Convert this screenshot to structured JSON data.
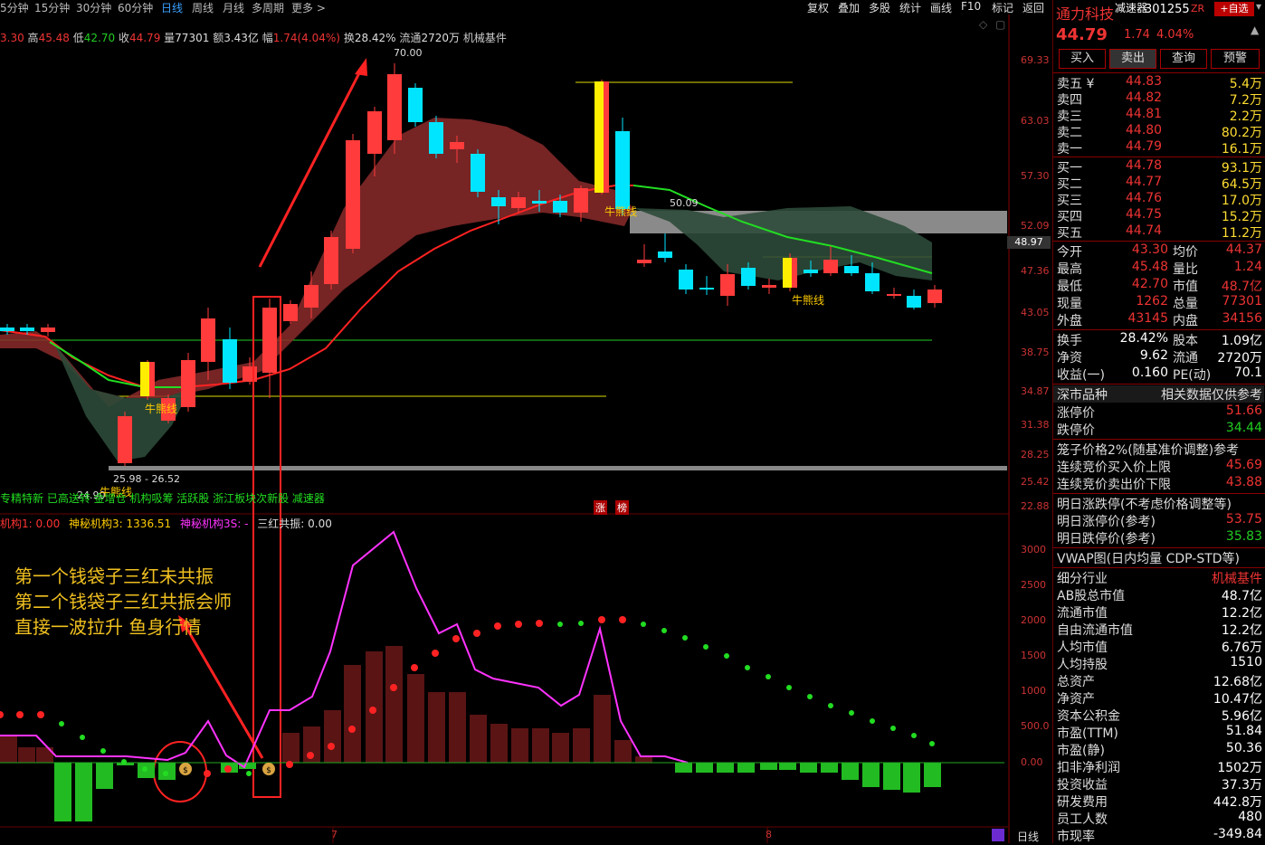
{
  "timeframes": [
    "5分钟",
    "15分钟",
    "30分钟",
    "60分钟",
    "日线",
    "周线",
    "月线",
    "多周期",
    "更多 >"
  ],
  "active_timeframe": "日线",
  "toolbar_right": [
    "复权",
    "叠加",
    "多股",
    "统计",
    "画线",
    "F10",
    "标记",
    "返回"
  ],
  "info": {
    "open": "3.30",
    "high_label": "高",
    "high": "45.48",
    "low_label": "低",
    "low": "42.70",
    "close_label": "收",
    "close": "44.79",
    "vol_label": "量",
    "vol": "77301",
    "amt_label": "额",
    "amt": "3.43亿",
    "chg_label": "幅",
    "chg": "1.74(4.04%)",
    "turn_label": "换",
    "turn": "28.42%",
    "float_label": "流通",
    "float": "2720万",
    "sector": "机械基件"
  },
  "annotations": {
    "high_mark": "70.00",
    "range_label": "25.98 - 26.52",
    "ma_value": "50.09",
    "price_tag": "48.97",
    "bull_bear_line": "牛熊线",
    "bottom_left_price": "24.90",
    "tag1": "涨",
    "tag2": "榜"
  },
  "concept_bar": "专精特新 已高送转 金增仓 机构吸筹 活跃股 浙江板块次新股 减速器",
  "indicator": {
    "label1": "机构1: 0.00",
    "label2": "神秘机构3: 1336.51",
    "label3": "神秘机构3S: -",
    "label4": "三红共振: 0.00"
  },
  "callout": [
    "第一个钱袋子三红未共振",
    "第二个钱袋子三红共振会师",
    "直接一波拉升  鱼身行情"
  ],
  "yaxis_main": [
    "69.33",
    "63.03",
    "57.30",
    "52.09",
    "47.36",
    "43.05",
    "38.75",
    "34.87",
    "31.38",
    "28.25",
    "25.42",
    "22.88"
  ],
  "yaxis_ind": [
    "3000",
    "2500",
    "2000",
    "1500",
    "1000",
    "500.0",
    "0.00"
  ],
  "xaxis": [
    "7",
    "8"
  ],
  "period_tag": "日线",
  "colors": {
    "up": "#ff3333",
    "down": "#00e5ff",
    "ma_green": "#22dd22",
    "ma_red": "#ff2222",
    "accent": "#ffcc00"
  },
  "right_panel": {
    "name": "通力科技",
    "tag": "减速器",
    "code": "301255",
    "badge": "ZR",
    "add_btn": "+自选",
    "price": "44.79",
    "change": "1.74",
    "pct": "4.04%",
    "buttons": [
      "买入",
      "卖出",
      "查询",
      "预警"
    ],
    "asks": [
      {
        "label": "卖五 ¥",
        "price": "44.83",
        "vol": "5.4万"
      },
      {
        "label": "卖四",
        "price": "44.82",
        "vol": "7.2万"
      },
      {
        "label": "卖三",
        "price": "44.81",
        "vol": "2.2万"
      },
      {
        "label": "卖二",
        "price": "44.80",
        "vol": "80.2万"
      },
      {
        "label": "卖一",
        "price": "44.79",
        "vol": "16.1万"
      }
    ],
    "bids": [
      {
        "label": "买一",
        "price": "44.78",
        "vol": "93.1万"
      },
      {
        "label": "买二",
        "price": "44.77",
        "vol": "64.5万"
      },
      {
        "label": "买三",
        "price": "44.76",
        "vol": "17.0万"
      },
      {
        "label": "买四",
        "price": "44.75",
        "vol": "15.2万"
      },
      {
        "label": "买五",
        "price": "44.74",
        "vol": "11.2万"
      }
    ],
    "stats": [
      {
        "l1": "今开",
        "v1": "43.30",
        "l2": "均价",
        "v2": "44.37"
      },
      {
        "l1": "最高",
        "v1": "45.48",
        "l2": "量比",
        "v2": "1.24"
      },
      {
        "l1": "最低",
        "v1": "42.70",
        "l2": "市值",
        "v2": "48.7亿"
      },
      {
        "l1": "现量",
        "v1": "1262",
        "l2": "总量",
        "v2": "77301"
      },
      {
        "l1": "外盘",
        "v1": "43145",
        "l2": "内盘",
        "v2": "34156"
      }
    ],
    "stats2": [
      {
        "l1": "换手",
        "v1": "28.42%",
        "l2": "股本",
        "v2": "1.09亿"
      },
      {
        "l1": "净资",
        "v1": "9.62",
        "l2": "流通",
        "v2": "2720万"
      },
      {
        "l1": "收益(一)",
        "v1": "0.160",
        "l2": "PE(动)",
        "v2": "70.1"
      }
    ],
    "market_label": "深市品种",
    "market_note": "相关数据仅供参考",
    "limits": [
      {
        "label": "涨停价",
        "value": "51.66"
      },
      {
        "label": "跌停价",
        "value": "34.44"
      }
    ],
    "cage_title": "笼子价格2%(随基准价调整)参考",
    "cage": [
      {
        "label": "连续竞价买入价上限",
        "value": "45.69"
      },
      {
        "label": "连续竞价卖出价下限",
        "value": "43.88"
      }
    ],
    "next_title": "明日涨跌停(不考虑价格调整等)",
    "next": [
      {
        "label": "明日涨停价(参考)",
        "value": "53.75"
      },
      {
        "label": "明日跌停价(参考)",
        "value": "35.83"
      }
    ],
    "vwap": "VWAP图(日内均量 CDP-STD等)",
    "fund": [
      {
        "label": "细分行业",
        "value": "机械基件"
      },
      {
        "label": "AB股总市值",
        "value": "48.7亿"
      },
      {
        "label": "流通市值",
        "value": "12.2亿"
      },
      {
        "label": "自由流通市值",
        "value": "12.2亿"
      },
      {
        "label": "人均市值",
        "value": "6.76万"
      },
      {
        "label": "人均持股",
        "value": "1510"
      },
      {
        "label": "总资产",
        "value": "12.68亿"
      },
      {
        "label": "净资产",
        "value": "10.47亿"
      },
      {
        "label": "资本公积金",
        "value": "5.96亿"
      },
      {
        "label": "市盈(TTM)",
        "value": "51.84"
      },
      {
        "label": "市盈(静)",
        "value": "50.36"
      },
      {
        "label": "扣非净利润",
        "value": "1502万"
      },
      {
        "label": "投资收益",
        "value": "37.3万"
      },
      {
        "label": "研发费用",
        "value": "442.8万"
      },
      {
        "label": "员工人数",
        "value": "480"
      },
      {
        "label": "市现率",
        "value": "-349.84"
      }
    ]
  }
}
